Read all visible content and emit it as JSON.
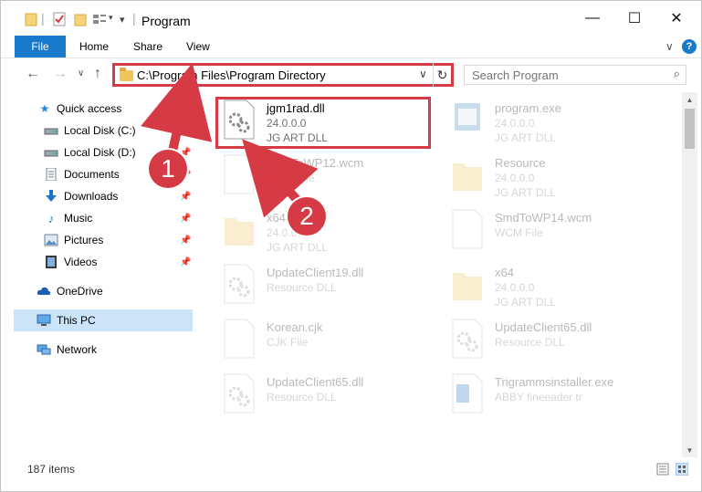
{
  "window": {
    "title": "Program",
    "minimize": "—",
    "maximize": "☐",
    "close": "✕"
  },
  "ribbon": {
    "file": "File",
    "home": "Home",
    "share": "Share",
    "view": "View",
    "expand": "∨",
    "help": "?"
  },
  "nav": {
    "back": "←",
    "forward": "→",
    "recent": "∨",
    "up": "↑"
  },
  "address": {
    "path": "C:\\Program Files\\Program Directory",
    "dropdown": "∨",
    "refresh": "↻"
  },
  "search": {
    "placeholder": "Search Program",
    "icon": "⌕"
  },
  "sidebar": {
    "items": [
      {
        "label": "Quick access",
        "icon": "star-icon",
        "pinned": false
      },
      {
        "label": "Local Disk (C:)",
        "icon": "drive-icon",
        "pinned": true
      },
      {
        "label": "Local Disk (D:)",
        "icon": "drive-icon",
        "pinned": true
      },
      {
        "label": "Documents",
        "icon": "documents-icon",
        "pinned": true
      },
      {
        "label": "Downloads",
        "icon": "download-icon",
        "pinned": true
      },
      {
        "label": "Music",
        "icon": "music-icon",
        "pinned": true
      },
      {
        "label": "Pictures",
        "icon": "pictures-icon",
        "pinned": true
      },
      {
        "label": "Videos",
        "icon": "videos-icon",
        "pinned": true
      },
      {
        "label": "OneDrive",
        "icon": "cloud-icon",
        "pinned": false
      },
      {
        "label": "This PC",
        "icon": "computer-icon",
        "pinned": false,
        "selected": true
      },
      {
        "label": "Network",
        "icon": "network-icon",
        "pinned": false
      }
    ]
  },
  "files": [
    {
      "name": "jgm1rad.dll",
      "line2": "24.0.0.0",
      "line3": "JG ART DLL",
      "type": "dll",
      "highlighted": true
    },
    {
      "name": "program.exe",
      "line2": "24.0.0.0",
      "line3": "JG ART DLL",
      "type": "exe"
    },
    {
      "name": "SmdToWP12.wcm",
      "line2": "WCM File",
      "line3": "",
      "type": "file"
    },
    {
      "name": "Resource",
      "line2": "24.0.0.0",
      "line3": "JG ART DLL",
      "type": "folder"
    },
    {
      "name": "x64",
      "line2": "24.0.0.0",
      "line3": "JG ART DLL",
      "type": "folder"
    },
    {
      "name": "SmdToWP14.wcm",
      "line2": "WCM File",
      "line3": "",
      "type": "file"
    },
    {
      "name": "UpdateClient19.dll",
      "line2": "Resource DLL",
      "line3": "",
      "type": "dll"
    },
    {
      "name": "x64",
      "line2": "24.0.0.0",
      "line3": "JG ART DLL",
      "type": "folder"
    },
    {
      "name": "Korean.cjk",
      "line2": "CJK File",
      "line3": "",
      "type": "file"
    },
    {
      "name": "UpdateClient65.dll",
      "line2": "Resource DLL",
      "line3": "",
      "type": "dll"
    },
    {
      "name": "UpdateClient65.dll",
      "line2": "Resource DLL",
      "line3": "",
      "type": "dll"
    },
    {
      "name": "Trigrammsinstaller.exe",
      "line2": "ABBY fineeader tr",
      "line3": "",
      "type": "exe2"
    }
  ],
  "status": {
    "count": "187 items"
  },
  "callouts": {
    "one": "1",
    "two": "2"
  },
  "colors": {
    "accent": "#1979ca",
    "highlight": "#d53a45",
    "selected": "#cce4f7"
  }
}
